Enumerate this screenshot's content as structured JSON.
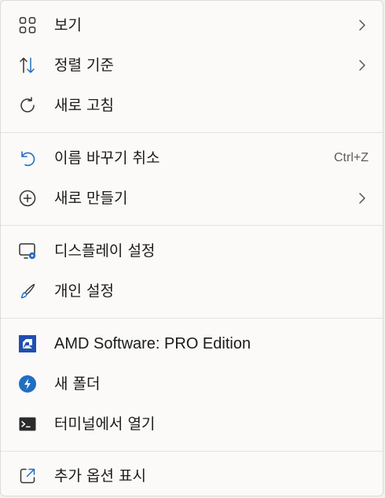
{
  "menu": {
    "items": [
      {
        "label": "보기",
        "icon": "grid-view-icon"
      },
      {
        "label": "정렬 기준",
        "icon": "sort-icon"
      },
      {
        "label": "새로 고침",
        "icon": "refresh-icon"
      },
      {
        "label": "이름 바꾸기 취소",
        "icon": "undo-icon",
        "shortcut": "Ctrl+Z"
      },
      {
        "label": "새로 만들기",
        "icon": "plus-circle-icon"
      },
      {
        "label": "디스플레이 설정",
        "icon": "display-settings-icon"
      },
      {
        "label": "개인 설정",
        "icon": "brush-icon"
      },
      {
        "label": "AMD Software: PRO Edition",
        "icon": "amd-logo-icon"
      },
      {
        "label": "새 폴더",
        "icon": "new-folder-app-icon"
      },
      {
        "label": "터미널에서 열기",
        "icon": "terminal-icon"
      },
      {
        "label": "추가 옵션 표시",
        "icon": "share-open-icon"
      }
    ]
  },
  "colors": {
    "accent": "#1f6fc2",
    "amd_red": "#1f4fb0",
    "text": "#1b1b1b",
    "muted": "#5c5c5c"
  }
}
